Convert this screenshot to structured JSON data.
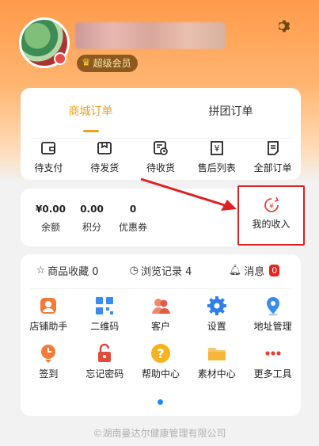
{
  "profile": {
    "vip_label": "超级会员"
  },
  "orders": {
    "tabs": [
      {
        "label": "商城订单",
        "active": true
      },
      {
        "label": "拼团订单",
        "active": false
      }
    ],
    "items": [
      {
        "label": "待支付",
        "icon": "wallet-icon"
      },
      {
        "label": "待发货",
        "icon": "box-icon"
      },
      {
        "label": "待收货",
        "icon": "truck-icon"
      },
      {
        "label": "售后列表",
        "icon": "yen-refund-icon"
      },
      {
        "label": "全部订单",
        "icon": "list-icon"
      }
    ]
  },
  "wallet": {
    "stats": [
      {
        "value": "¥0.00",
        "label": "余额"
      },
      {
        "value": "0.00",
        "label": "积分"
      },
      {
        "value": "0",
        "label": "优惠券"
      }
    ],
    "income_label": "我的收入"
  },
  "tools": {
    "favorites": "商品收藏 0",
    "history": "浏览记录 4",
    "messages": "消息",
    "message_count": "0",
    "grid": [
      {
        "label": "店铺助手",
        "icon": "shop-assistant-icon"
      },
      {
        "label": "二维码",
        "icon": "qrcode-icon"
      },
      {
        "label": "客户",
        "icon": "customers-icon"
      },
      {
        "label": "设置",
        "icon": "gear-icon"
      },
      {
        "label": "地址管理",
        "icon": "location-icon"
      },
      {
        "label": "签到",
        "icon": "checkin-icon"
      },
      {
        "label": "忘记密码",
        "icon": "lock-icon"
      },
      {
        "label": "帮助中心",
        "icon": "help-icon"
      },
      {
        "label": "素材中心",
        "icon": "folder-icon"
      },
      {
        "label": "更多工具",
        "icon": "more-icon"
      }
    ]
  },
  "footer": "©湖南曼达尔健康管理有限公司",
  "colors": {
    "accent": "#f0a020",
    "header_orange": "#ff9a4a",
    "highlight_red": "#e02020"
  }
}
